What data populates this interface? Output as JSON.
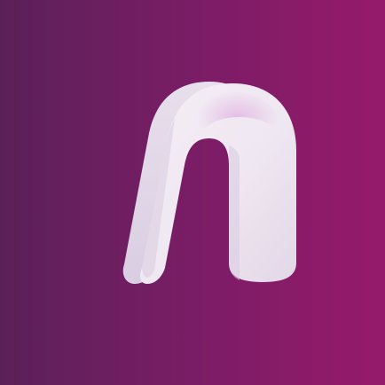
{
  "icon": {
    "name": "n-logo-icon",
    "colors": {
      "background_left": "#5a2158",
      "background_mid": "#7a1d66",
      "background_right": "#961a6c",
      "glyph_light": "#f2ecf3",
      "glyph_mid": "#e3d9e8",
      "glyph_shadow": "#c8b9d2",
      "glyph_pink_tint": "#e9c3e6"
    }
  }
}
